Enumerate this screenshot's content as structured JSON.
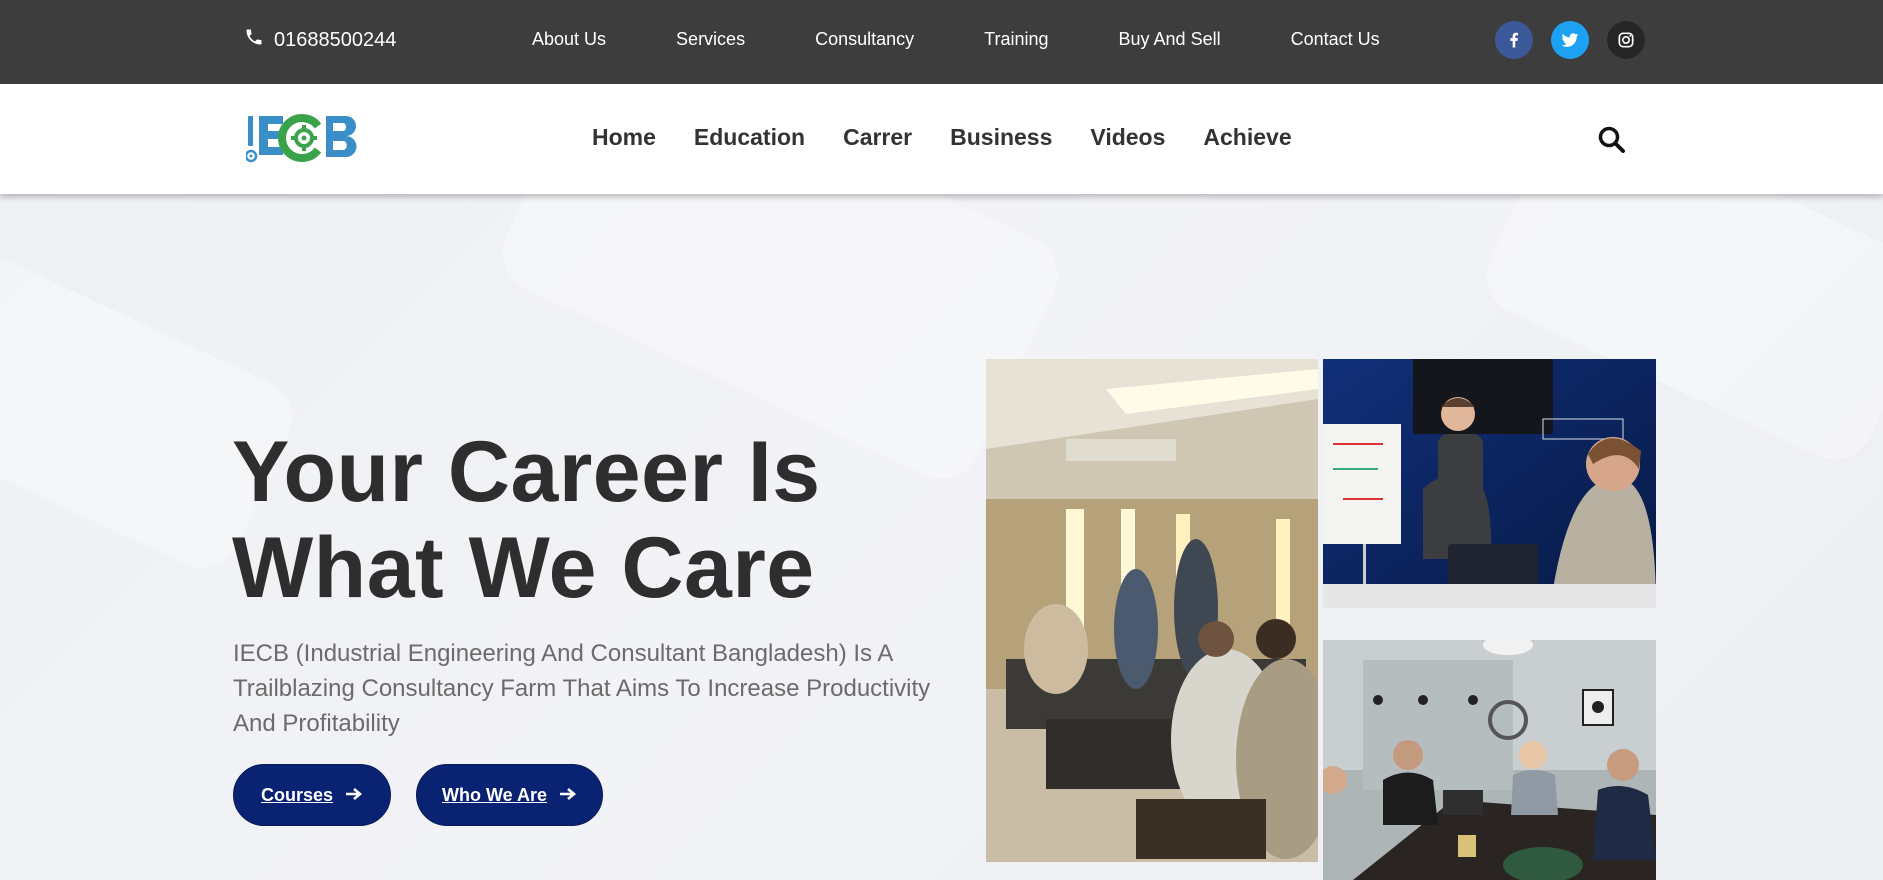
{
  "topbar": {
    "phone": "01688500244",
    "links": [
      "About Us",
      "Services",
      "Consultancy",
      "Training",
      "Buy And Sell",
      "Contact Us"
    ],
    "social": [
      "facebook-icon",
      "twitter-icon",
      "instagram-icon"
    ]
  },
  "header": {
    "logo_text": "IECB",
    "nav": [
      "Home",
      "Education",
      "Carrer",
      "Business",
      "Videos",
      "Achieve"
    ]
  },
  "hero": {
    "headline_line1": "Your Career Is",
    "headline_line2": "What We Care",
    "description": "IECB (Industrial Engineering And Consultant Bangladesh) Is A Trailblazing Consultancy Farm That Aims To Increase Productivity And Profitability",
    "button_courses": "Courses",
    "button_who": "Who We Are"
  },
  "colors": {
    "topbar_bg": "#3d3d3d",
    "button_bg": "#0a2272",
    "logo_blue": "#3a8fc8",
    "logo_green": "#3aa24b",
    "facebook": "#3b5998",
    "twitter": "#1da1f2"
  }
}
